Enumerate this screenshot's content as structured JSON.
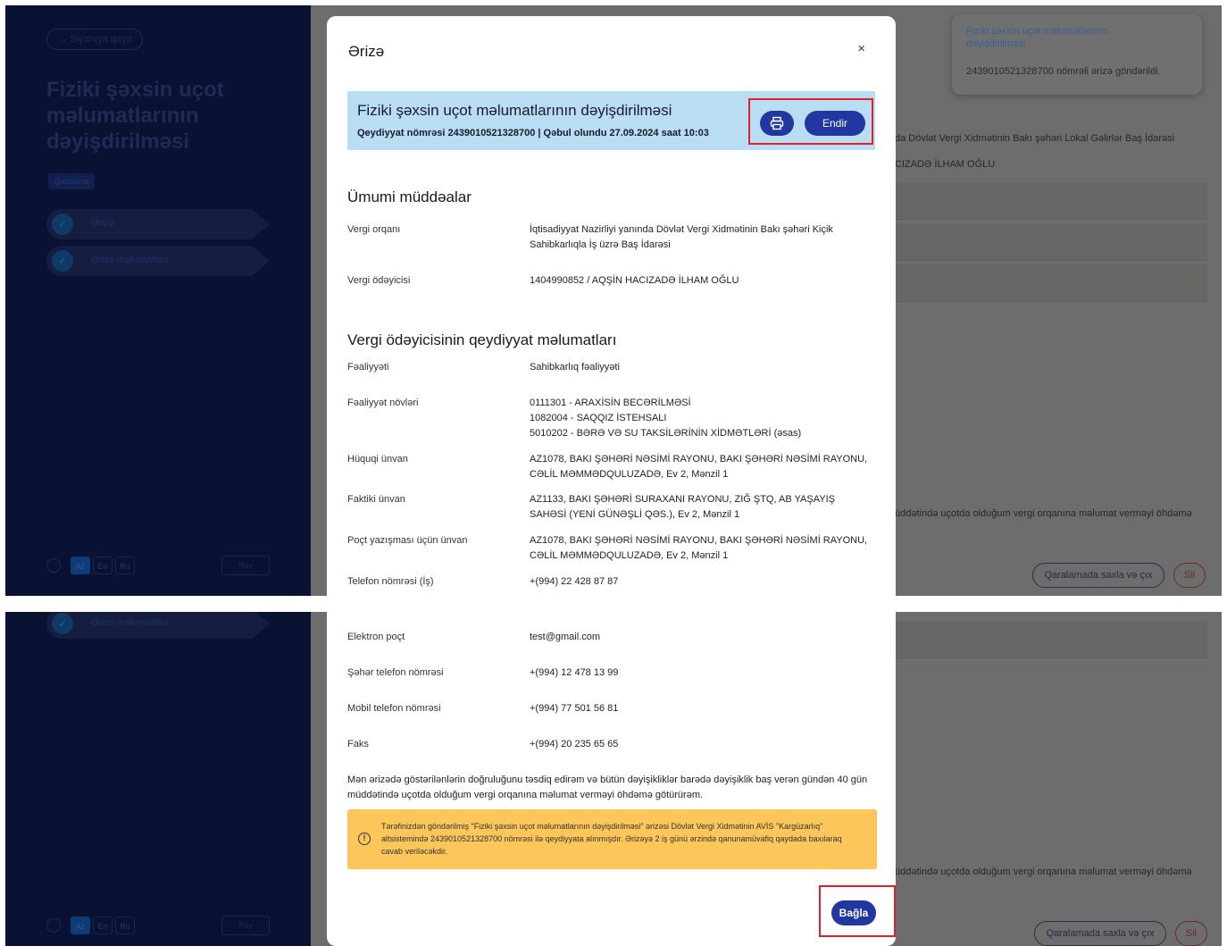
{
  "sidebar": {
    "back_label": "← Siyahıya qayıt",
    "title": "Fiziki şəxsin uçot məlumatlarının dəyişdirilməsi",
    "badge": "Qaralama",
    "steps": [
      "Ərizə",
      "Ərizə məlumatları"
    ],
    "languages": [
      "Az",
      "En",
      "Ru"
    ],
    "feedback_label": "Rəy"
  },
  "background": {
    "toast_title": "Fiziki şəxsin uçot məlumatlarının dəyişdirilməsi",
    "toast_message": "2439010521328700 nömrəli ərizə göndərildi.",
    "authority_text": "da Dövlət Vergi Xidmətinin Bakı şəhəri Lokal Gəlirlər Baş İdarəsi",
    "taxpayer_text": "CIZADƏ İLHAM OĞLU",
    "declaration_text": "üddətində uçotda olduğum vergi orqanına məlumat verməyi öhdəmə",
    "save_draft_label": "Qaralamada saxla və çıx",
    "delete_label": "Sil"
  },
  "modal": {
    "title": "Ərizə",
    "close_label": "×",
    "banner_title": "Fiziki şəxsin uçot məlumatlarının dəyişdirilməsi",
    "banner_subtitle": "Qeydiyyat nömrəsi 2439010521328700 | Qəbul olundu 27.09.2024 saat 10:03",
    "download_label": "Endir",
    "general_heading": "Ümumi müddəalar",
    "general": [
      {
        "label": "Vergi orqanı",
        "value": "İqtisadiyyat Nazirliyi yanında Dövlət Vergi Xidmətinin Bakı şəhəri Kiçik Sahibkarlıqla İş üzrə Baş İdarəsi"
      },
      {
        "label": "Vergi ödəyicisi",
        "value": "1404990852 / AQŞİN HACIZADƏ İLHAM OĞLU"
      }
    ],
    "registration_heading": "Vergi ödəyicisinin qeydiyyat məlumatları",
    "registration": [
      {
        "label": "Fəaliyyəti",
        "value": "Sahibkarlıq fəaliyyəti"
      },
      {
        "label": "Fəaliyyət növləri",
        "lines": [
          "0111301 - ARAXİSİN BECƏRİLMƏSİ",
          "1082004 - SAQQIZ İSTEHSALI",
          "5010202 - BƏRƏ VƏ SU TAKSİLƏRİNİN XİDMƏTLƏRİ (əsas)"
        ]
      },
      {
        "label": "Hüquqi ünvan",
        "value": "AZ1078, BAKI ŞƏHƏRİ NƏSİMİ RAYONU, BAKI ŞƏHƏRİ NƏSİMİ RAYONU, CƏLİL MƏMMƏDQULUZADƏ, Ev 2, Mənzil 1"
      },
      {
        "label": "Faktiki ünvan",
        "value": "AZ1133, BAKI ŞƏHƏRİ SURAXANI RAYONU, ZIĞ ŞTQ, AB YAŞAYIŞ SAHƏSİ (YENİ GÜNƏŞLİ QƏS.), Ev 2, Mənzil 1"
      },
      {
        "label": "Poçt yazışması üçün ünvan",
        "value": "AZ1078, BAKI ŞƏHƏRİ NƏSİMİ RAYONU, BAKI ŞƏHƏRİ NƏSİMİ RAYONU, CƏLİL MƏMMƏDQULUZADƏ, Ev 2, Mənzil 1"
      },
      {
        "label": "Telefon nömrəsi (İş)",
        "value": "+(994) 22 428 87 87"
      }
    ],
    "contacts": [
      {
        "label": "Elektron poçt",
        "value": "test@gmail.com"
      },
      {
        "label": "Şəhər telefon nömrəsi",
        "value": "+(994) 12 478 13 99"
      },
      {
        "label": "Mobil telefon nömrəsi",
        "value": "+(994) 77 501 56 81"
      },
      {
        "label": "Faks",
        "value": "+(994) 20 235 65 65"
      }
    ],
    "confirmation": "Mən ərizədə göstərilənlərin doğruluğunu təsdiq edirəm və bütün dəyişikliklər barədə dəyişiklik baş verən gündən 40 gün müddətində uçotda olduğum vergi orqanına məlumat verməyi öhdəmə götürürəm.",
    "warning": "Tərəfinizdən göndərilmiş \"Fiziki şəxsin uçot məlumatlarının dəyişdirilməsi\" ərizəsi Dövlət Vergi Xidmətinin AVİS \"Kargüzarlıq\" altsistemində 2439010521328700 nömrəsi ilə qeydiyyata alınmışdır. Ərizəyə 2 iş günü ərzində qanunamüvafiq qaydada baxılaraq cavab veriləcəkdir.",
    "close_button_label": "Bağla"
  },
  "colors": {
    "primary": "#2238a0",
    "banner_bg": "#b9ddf3",
    "warning_bg": "#fcc65b",
    "highlight": "#e0202a",
    "sidebar_bg": "#0a1233"
  }
}
